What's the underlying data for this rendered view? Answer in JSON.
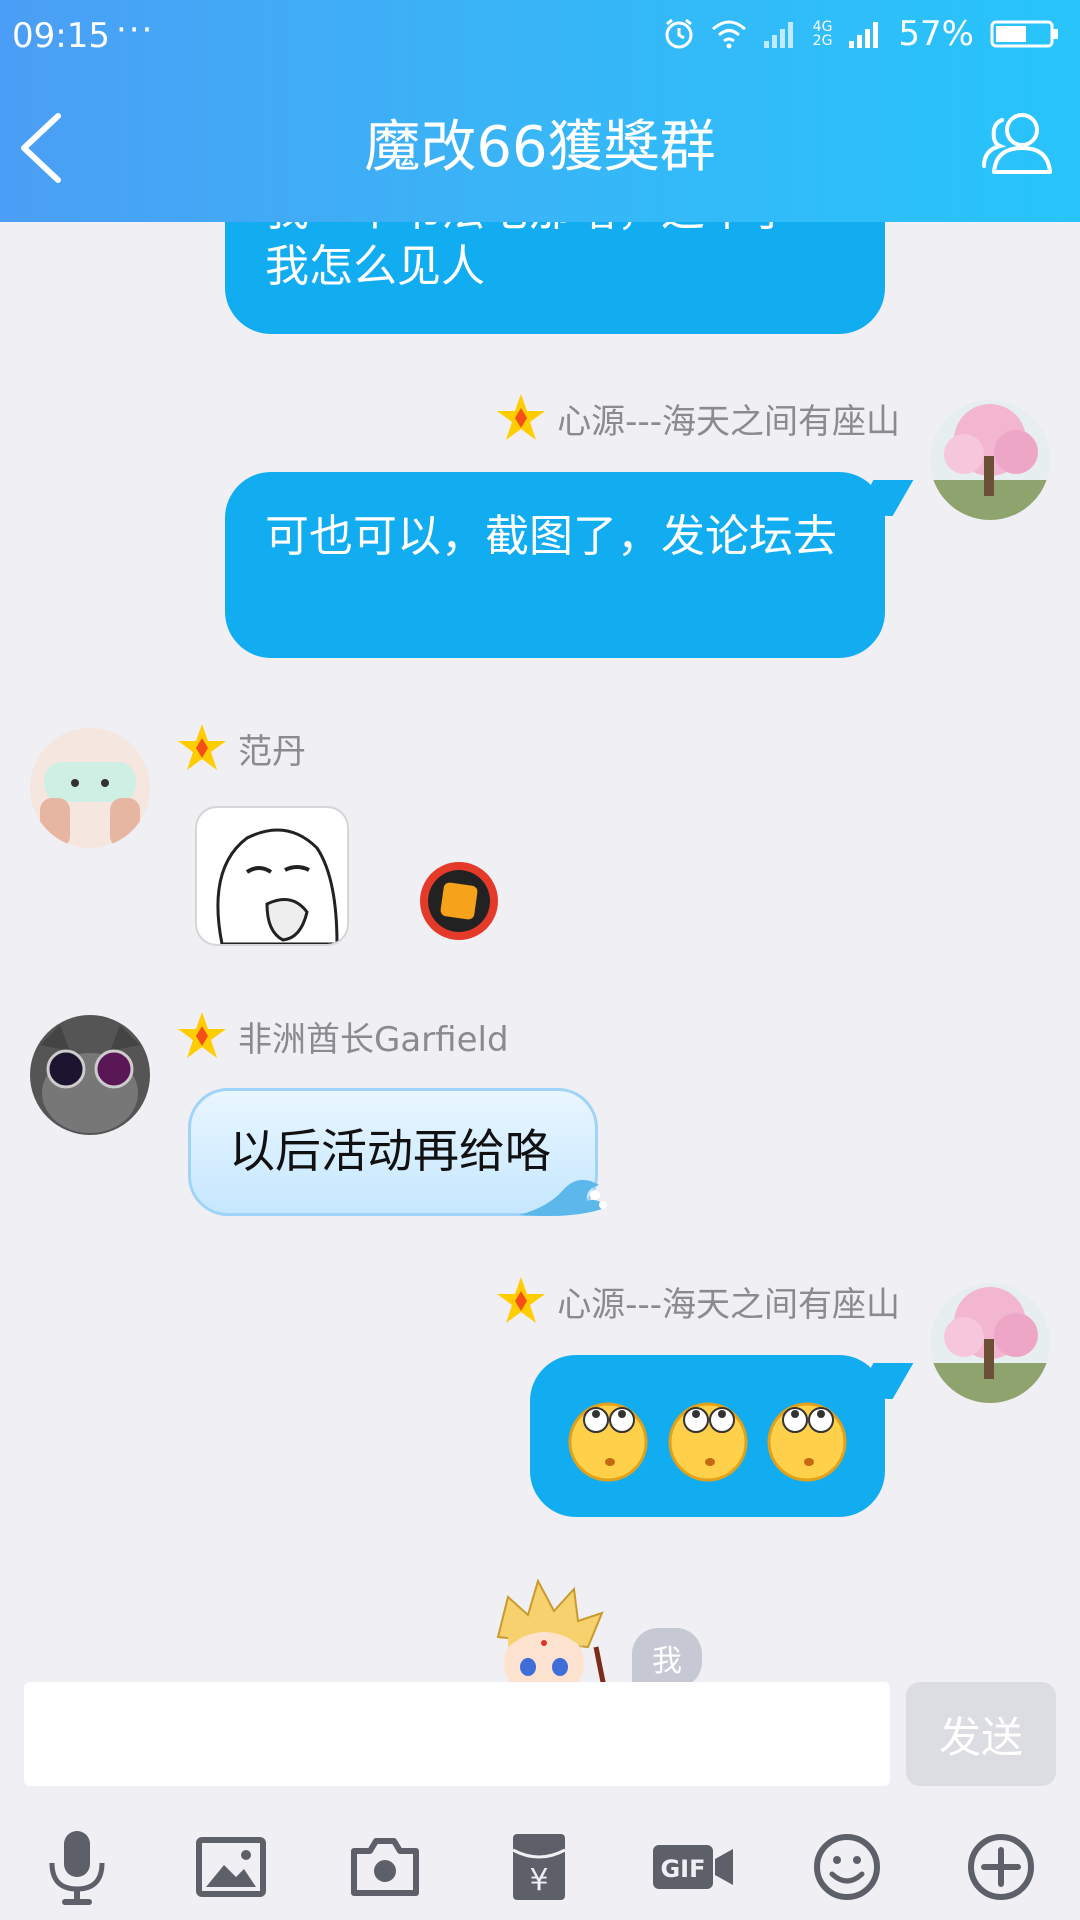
{
  "status_bar": {
    "time": "09:15",
    "more": "···",
    "network_top": "4G",
    "network_bottom": "2G",
    "battery": "57%"
  },
  "header": {
    "title": "魔改66獲獎群"
  },
  "messages": {
    "m1": {
      "text": "我怎么见人",
      "partial_text": "我一个书法宅那嗐，这举了"
    },
    "m2": {
      "sender": "心源---海天之间有座山",
      "text": "可也可以，截图了，发论坛去"
    },
    "m3": {
      "sender": "范丹"
    },
    "m4": {
      "sender": "非洲酋长Garfield",
      "text": "以后活动再给咯"
    },
    "m5": {
      "sender": "心源---海天之间有座山"
    },
    "m6": {
      "tag": "我"
    }
  },
  "input": {
    "placeholder": "",
    "value": "",
    "send_label": "发送"
  },
  "colors": {
    "header_gradient_start": "#4b9ef5",
    "header_gradient_end": "#27c4fb",
    "bubble_blue": "#12adf0",
    "background": "#efeff4",
    "name_gray": "#8a8a8f"
  },
  "toolbar_icons": [
    "microphone-icon",
    "image-icon",
    "camera-icon",
    "red-packet-icon",
    "gif-icon",
    "emoji-icon",
    "plus-icon"
  ]
}
